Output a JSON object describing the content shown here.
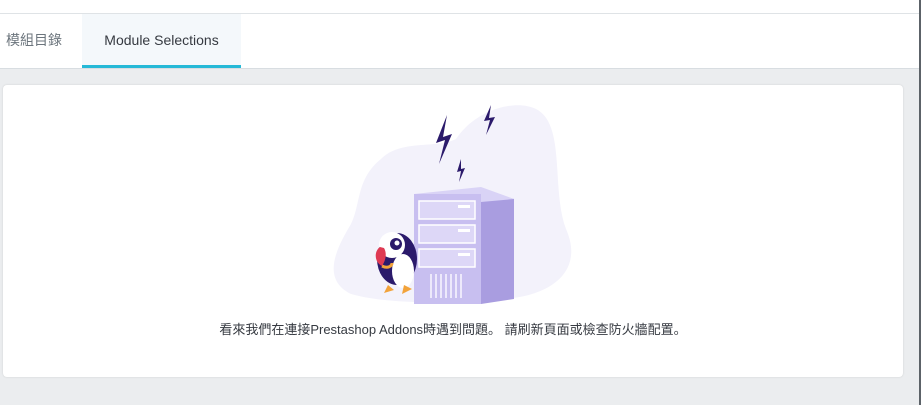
{
  "tabs": [
    {
      "label": "模組目錄",
      "active": false
    },
    {
      "label": "Module Selections",
      "active": true
    }
  ],
  "error": {
    "message": "看來我們在連接Prestashop Addons時遇到問題。 請刷新頁面或檢查防火牆配置。"
  },
  "colors": {
    "accent": "#25b9d7",
    "illustration_bg": "#f3f2fb",
    "server": "#c8bff0",
    "lightning": "#2b1a6b"
  },
  "icons": {
    "illustration": "disconnected-server-with-puffin"
  }
}
